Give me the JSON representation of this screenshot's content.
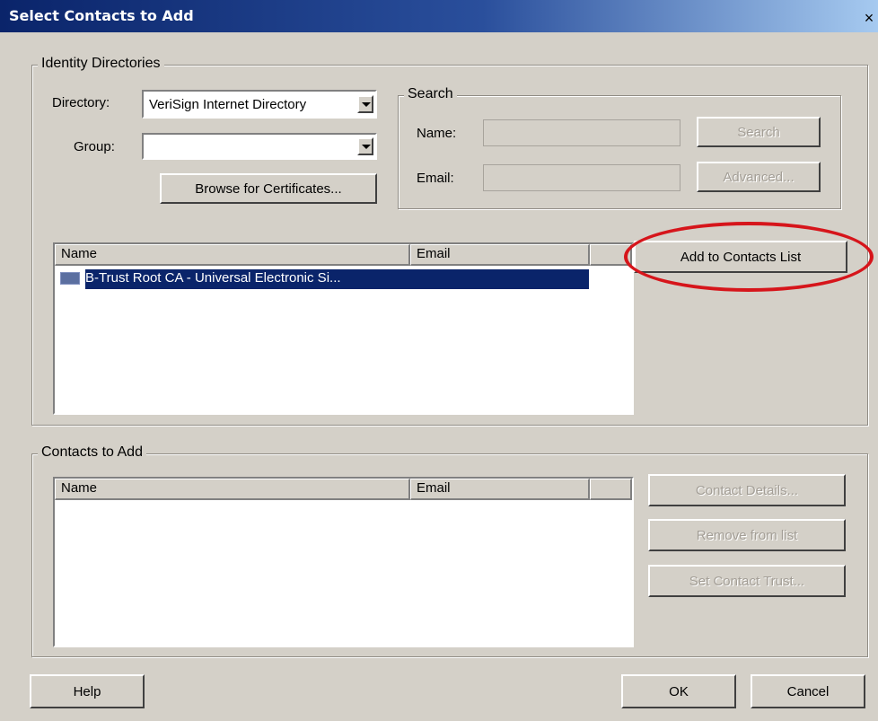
{
  "window": {
    "title": "Select Contacts to Add",
    "close_glyph": "×"
  },
  "identity": {
    "group_label": "Identity Directories",
    "directory_label": "Directory:",
    "directory_value": "VeriSign Internet Directory",
    "group_field_label": "Group:",
    "group_value": "",
    "browse_button": "Browse for Certificates..."
  },
  "search": {
    "group_label": "Search",
    "name_label": "Name:",
    "email_label": "Email:",
    "search_button": "Search",
    "advanced_button": "Advanced..."
  },
  "results": {
    "columns": [
      "Name",
      "Email"
    ],
    "rows": [
      {
        "name": "B-Trust Root CA - Universal Electronic Si...",
        "email": ""
      }
    ],
    "add_button": "Add to Contacts List"
  },
  "contacts": {
    "group_label": "Contacts to Add",
    "columns": [
      "Name",
      "Email"
    ],
    "details_button": "Contact Details...",
    "remove_button": "Remove from list",
    "trust_button": "Set Contact Trust..."
  },
  "footer": {
    "help": "Help",
    "ok": "OK",
    "cancel": "Cancel"
  },
  "annotation": {
    "color": "#d6151b"
  }
}
